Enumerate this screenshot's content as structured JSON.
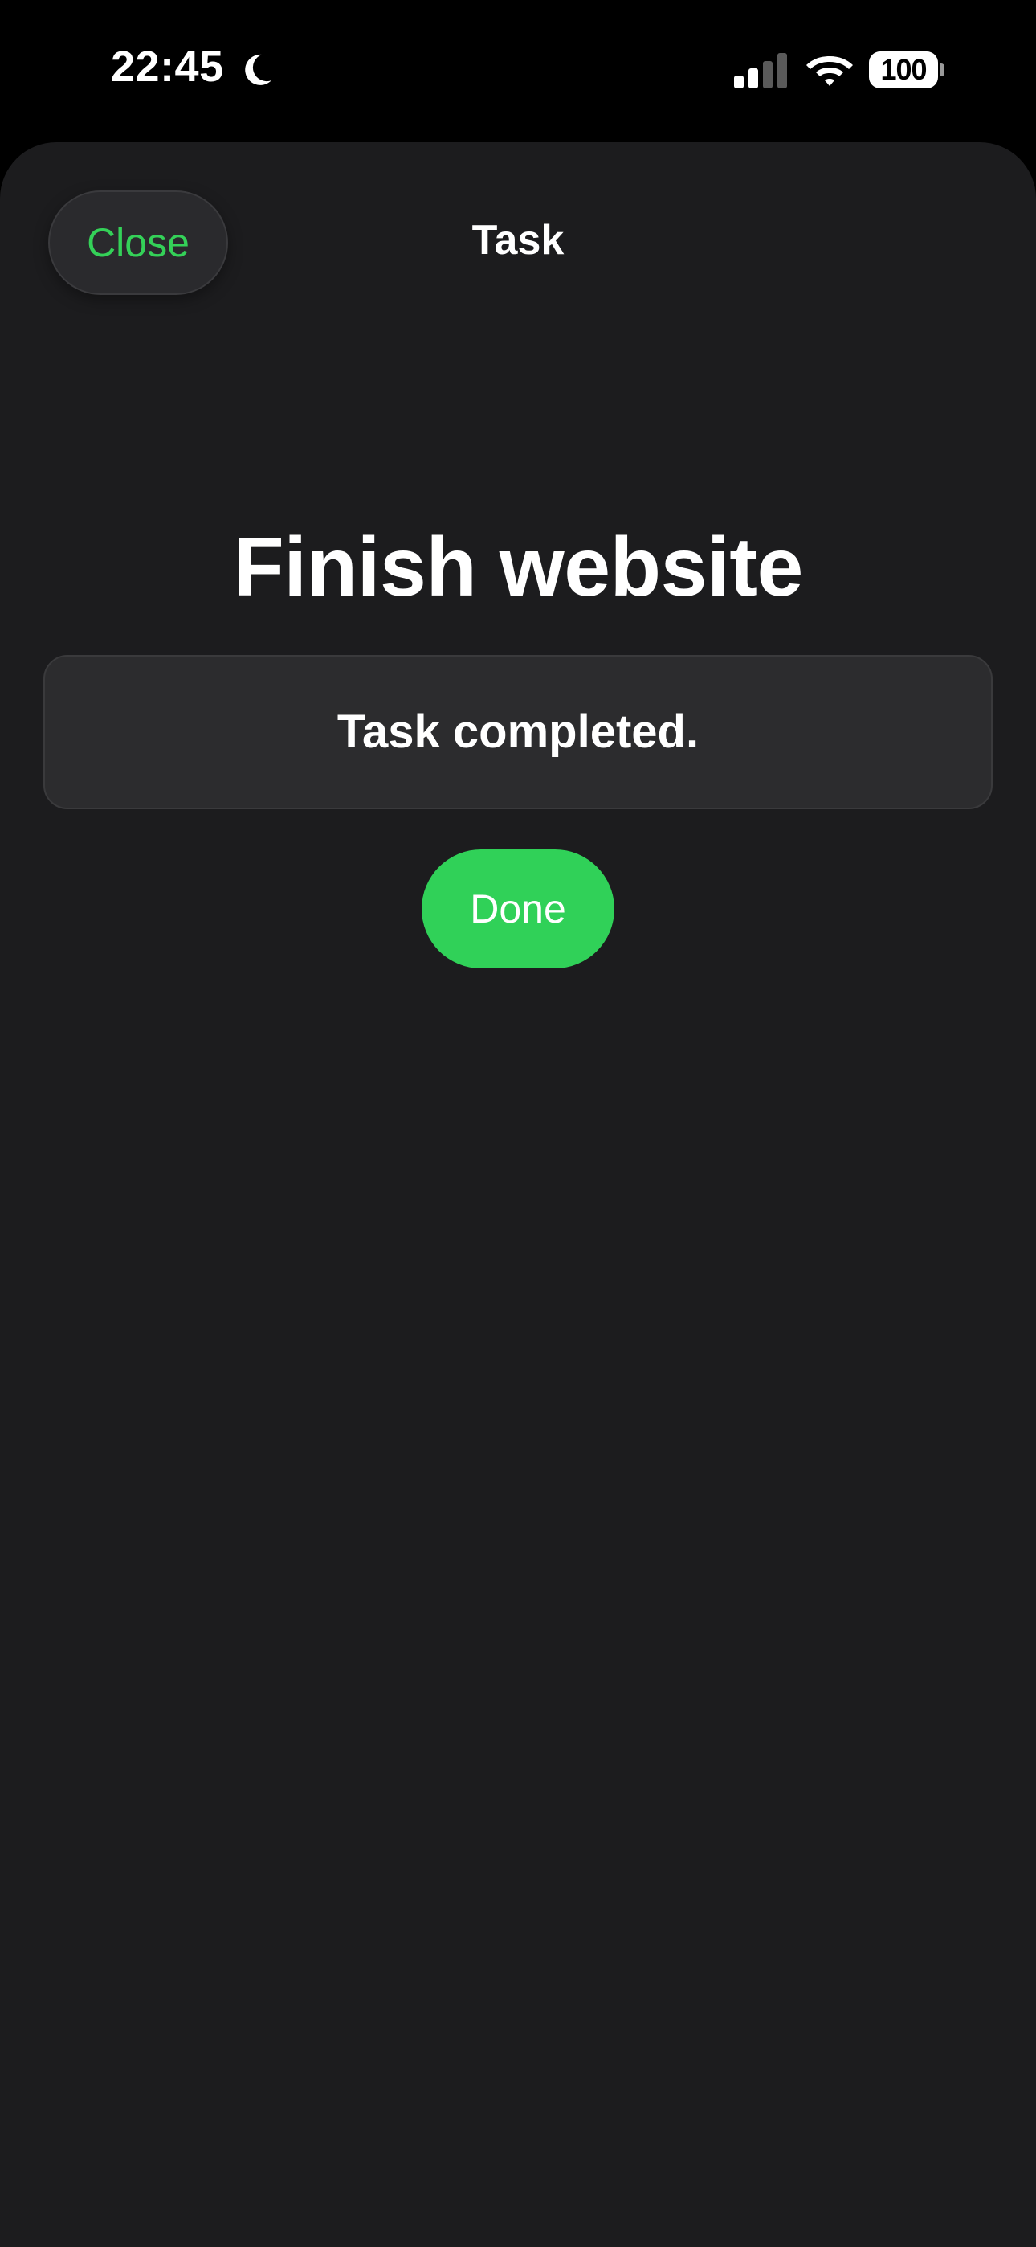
{
  "status_bar": {
    "time": "22:45",
    "focus_icon": "moon-icon",
    "signal_icon": "cellular-signal-icon",
    "wifi_icon": "wifi-icon",
    "battery_level": "100"
  },
  "nav": {
    "close_label": "Close",
    "title": "Task"
  },
  "task": {
    "title": "Finish website",
    "status_message": "Task completed.",
    "done_label": "Done"
  },
  "colors": {
    "accent": "#30d158",
    "close_text": "#34d158",
    "sheet_background": "#1c1c1e",
    "message_background": "#2c2c2e"
  }
}
